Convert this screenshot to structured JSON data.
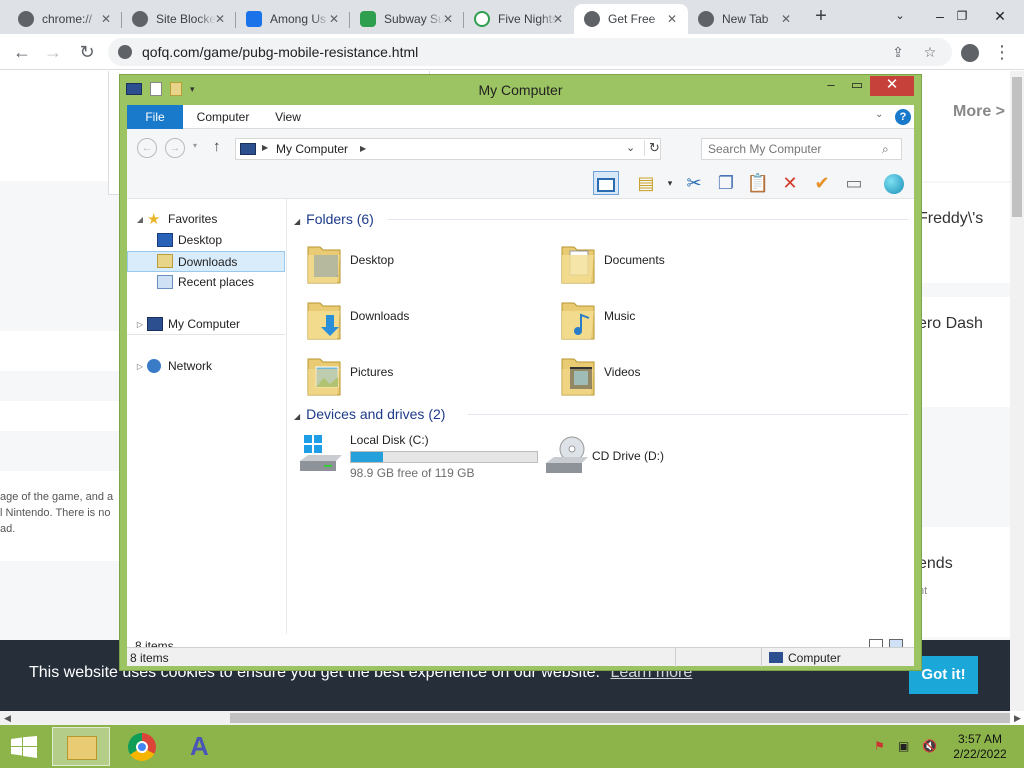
{
  "browser": {
    "tabs": [
      {
        "label": "chrome://",
        "color": "#5f6368"
      },
      {
        "label": "Site Blocker",
        "color": "#5f6368"
      },
      {
        "label": "Among Us",
        "color": "#1a73e8"
      },
      {
        "label": "Subway Surfers",
        "color": "#2e9e4f"
      },
      {
        "label": "Five Nights at Freddy's",
        "color": "#2e9e4f"
      },
      {
        "label": "Get Free",
        "color": "#5f6368"
      },
      {
        "label": "New Tab",
        "color": "#5f6368"
      }
    ],
    "url": "qofq.com/game/pubg-mobile-resistance.html"
  },
  "webpage": {
    "more_link": "More >",
    "side_titles": [
      "Freddy\\'s",
      "ero Dash",
      "ends"
    ],
    "side_sub": "nt",
    "desc_lines": [
      "age of the game, and a",
      "l Nintendo. There is no",
      "ad."
    ],
    "cookie_text": "This website uses cookies to ensure you get the best experience on our website.",
    "cookie_link": "Learn more",
    "cookie_button": "Got it!"
  },
  "explorer": {
    "title": "My Computer",
    "ribbon_tabs": [
      "File",
      "Computer",
      "View"
    ],
    "address": "My Computer",
    "search_placeholder": "Search My Computer",
    "nav_pane": {
      "favorites": "Favorites",
      "favorites_children": [
        "Desktop",
        "Downloads",
        "Recent places"
      ],
      "selected": "Downloads",
      "computer": "My Computer",
      "network": "Network"
    },
    "folders_header": "Folders (6)",
    "folders": [
      "Desktop",
      "Documents",
      "Downloads",
      "Music",
      "Pictures",
      "Videos"
    ],
    "devices_header": "Devices and drives (2)",
    "drives": [
      {
        "name": "Local Disk (C:)",
        "free": "98.9 GB free of 119 GB",
        "used_fraction": 0.17
      },
      {
        "name": "CD Drive (D:)"
      }
    ],
    "status_count": "8 items",
    "lower_status_count": "8 items",
    "lower_status_location": "Computer"
  },
  "taskbar": {
    "time": "3:57 AM",
    "date": "2/22/2022"
  },
  "colors": {
    "window_frame": "#9cc462",
    "taskbar": "#8db44b",
    "accent_blue": "#1979ca",
    "drive_fill": "#26a0da"
  }
}
